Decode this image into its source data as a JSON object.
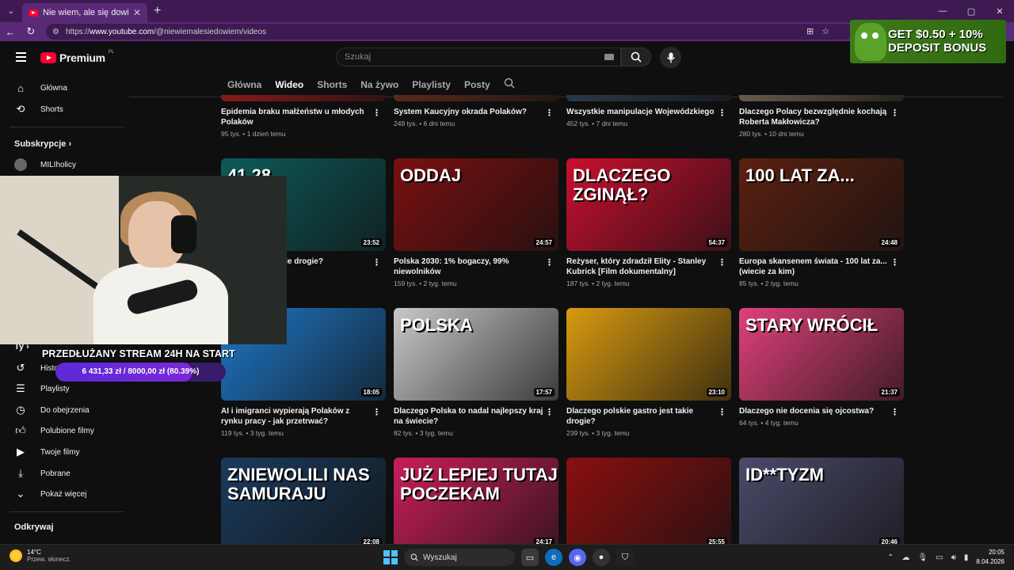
{
  "browser": {
    "tab_title": "Nie wiem, ale się dowiem! - YouTube",
    "url_prefix": "https://",
    "url_domain": "www.youtube.com",
    "url_path": "/@niewiemalesiedowiem/videos"
  },
  "header": {
    "logo_text": "Premium",
    "logo_country": "PL",
    "search_placeholder": "Szukaj"
  },
  "ad": {
    "line1": "GET $0.50 + 10%",
    "line2": "DEPOSIT BONUS"
  },
  "channel_tabs": [
    {
      "label": "Główna",
      "active": false
    },
    {
      "label": "Wideo",
      "active": true
    },
    {
      "label": "Shorts",
      "active": false
    },
    {
      "label": "Na żywo",
      "active": false
    },
    {
      "label": "Playlisty",
      "active": false
    },
    {
      "label": "Posty",
      "active": false
    }
  ],
  "sidebar": {
    "main": [
      {
        "label": "Główna",
        "icon": "home-icon"
      },
      {
        "label": "Shorts",
        "icon": "shorts-icon"
      }
    ],
    "subs_heading": "Subskrypcje",
    "subs": [
      {
        "label": "MILIholicy"
      }
    ],
    "you_heading": "Ty",
    "you": [
      {
        "label": "Historia",
        "icon": "history-icon"
      },
      {
        "label": "Playlisty",
        "icon": "playlist-icon"
      },
      {
        "label": "Do obejrzenia",
        "icon": "clock-icon"
      },
      {
        "label": "Polubione filmy",
        "icon": "like-icon"
      },
      {
        "label": "Twoje filmy",
        "icon": "video-icon"
      },
      {
        "label": "Pobrane",
        "icon": "download-icon"
      },
      {
        "label": "Pokaż więcej",
        "icon": "chevron-down-icon"
      }
    ],
    "explore_heading": "Odkrywaj"
  },
  "videos": [
    {
      "title": "Epidemia braku małżeństw u młodych Polaków",
      "views": "95 tys.",
      "age": "1 dzień temu",
      "duration": "",
      "thumb": "#8a1a1a",
      "overlay": ""
    },
    {
      "title": "System Kaucyjny okrada Polaków?",
      "views": "249 tys.",
      "age": "6 dni temu",
      "duration": "",
      "thumb": "#5a2a1a",
      "overlay": ""
    },
    {
      "title": "Wszystkie manipulacje Wojewódzkiego",
      "views": "452 tys.",
      "age": "7 dni temu",
      "duration": "",
      "thumb": "#2a3a4a",
      "overlay": ""
    },
    {
      "title": "Dlaczego Polacy bezwzględnie kochają Roberta Makłowicza?",
      "views": "280 tys.",
      "age": "10 dni temu",
      "duration": "",
      "thumb": "#6a5a4a",
      "overlay": ""
    },
    {
      "title": "Dlaczego jest takie drogie?",
      "views": "",
      "age": "",
      "duration": "23:52",
      "thumb": "#0e5a5a",
      "overlay": "41,28"
    },
    {
      "title": "Polska 2030: 1% bogaczy, 99% niewolników",
      "views": "159 tys.",
      "age": "2 tyg. temu",
      "duration": "24:57",
      "thumb": "#7a1010",
      "overlay": "ODDAJ"
    },
    {
      "title": "Reżyser, który zdradził Elity - Stanley Kubrick [Film dokumentalny]",
      "views": "187 tys.",
      "age": "2 tyg. temu",
      "duration": "54:37",
      "thumb": "#c8102e",
      "overlay": "DLACZEGO ZGINĄŁ?"
    },
    {
      "title": "Europa skansenem świata - 100 lat za... (wiecie za kim)",
      "views": "85 tys.",
      "age": "2 tyg. temu",
      "duration": "24:48",
      "thumb": "#5a2010",
      "overlay": "100 LAT ZA..."
    },
    {
      "title": "AI i imigranci wypierają Polaków z rynku pracy - jak przetrwać?",
      "views": "119 tys.",
      "age": "3 tyg. temu",
      "duration": "18:05",
      "thumb": "#1e78c8",
      "overlay": ""
    },
    {
      "title": "Dlaczego Polska to nadal najlepszy kraj na świecie?",
      "views": "82 tys.",
      "age": "3 tyg. temu",
      "duration": "17:57",
      "thumb": "#c8c8c8",
      "overlay": "POLSKA"
    },
    {
      "title": "Dlaczego polskie gastro jest takie drogie?",
      "views": "239 tys.",
      "age": "3 tyg. temu",
      "duration": "23:10",
      "thumb": "#d89a10",
      "overlay": ""
    },
    {
      "title": "Dlaczego nie docenia się ojcostwa?",
      "views": "64 tys.",
      "age": "4 tyg. temu",
      "duration": "21:37",
      "thumb": "#e0407a",
      "overlay": "STARY WRÓCIŁ"
    },
    {
      "title": "",
      "views": "",
      "age": "",
      "duration": "22:08",
      "thumb": "#1a3a5a",
      "overlay": "ZNIEWOLILI NAS SAMURAJU"
    },
    {
      "title": "",
      "views": "",
      "age": "",
      "duration": "24:17",
      "thumb": "#c81e5a",
      "overlay": "JUŻ LEPIEJ TUTAJ POCZEKAM"
    },
    {
      "title": "",
      "views": "",
      "age": "",
      "duration": "25:55",
      "thumb": "#8a1010",
      "overlay": ""
    },
    {
      "title": "",
      "views": "",
      "age": "",
      "duration": "20:46",
      "thumb": "#4a4a6a",
      "overlay": "ID**TYZM"
    }
  ],
  "stream": {
    "title": "PRZEDŁUŻANY STREAM 24H NA START",
    "progress_text": "6 431,33 zł / 8000,00 zł (80.39%)",
    "progress": 0.8039
  },
  "taskbar": {
    "temp": "14°C",
    "weather": "Przew. słonecz.",
    "search": "Wyszukaj",
    "time": "20:05",
    "date": "8.04.2026"
  }
}
